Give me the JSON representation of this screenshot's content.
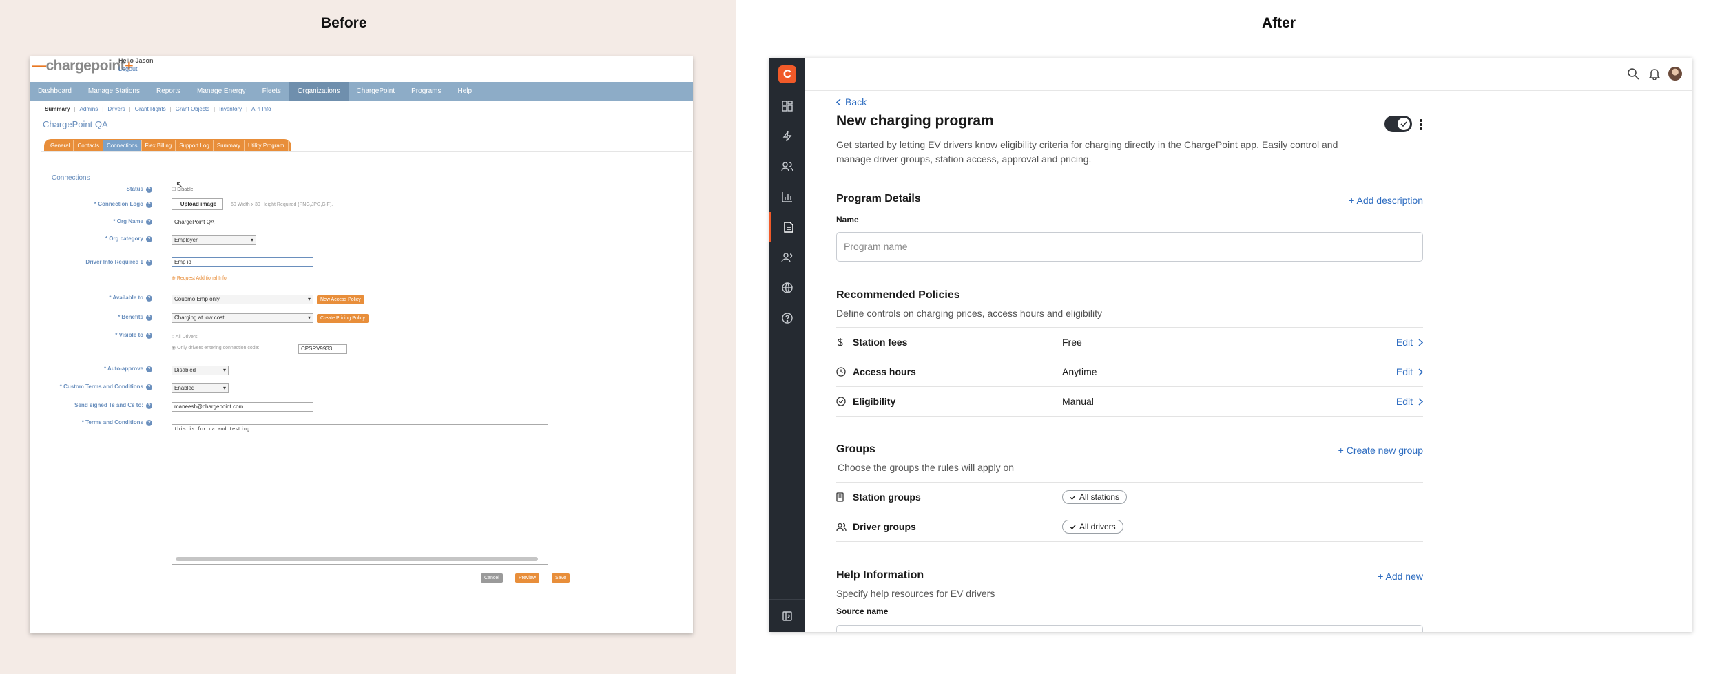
{
  "labels": {
    "before": "Before",
    "after": "After"
  },
  "old": {
    "logo": "chargepoint",
    "hello": "Hello Jason",
    "logout": "Logout",
    "nav": [
      "Dashboard",
      "Manage Stations",
      "Reports",
      "Manage Energy",
      "Fleets",
      "Organizations",
      "ChargePoint",
      "Programs",
      "Help"
    ],
    "subnav": [
      "Summary",
      "Admins",
      "Drivers",
      "Grant Rights",
      "Grant Objects",
      "Inventory",
      "API Info"
    ],
    "org_title": "ChargePoint QA",
    "tabs": [
      "General",
      "Contacts",
      "Connections",
      "Flex Billing",
      "Support Log",
      "Summary",
      "Utility Program"
    ],
    "panel_title": "Connections",
    "fields": {
      "status_label": "Status",
      "status_value": "Disable",
      "logo_label": "* Connection Logo",
      "logo_button": "Upload image",
      "logo_hint": "60 Width x 30 Height Required (PNG,JPG,GIF).",
      "org_name_label": "* Org Name",
      "org_name_value": "ChargePoint QA",
      "org_cat_label": "* Org category",
      "org_cat_value": "Employer",
      "driver_info_label": "Driver Info Required 1",
      "driver_info_value": "Emp id",
      "request_info": "Request Additional Info",
      "available_label": "* Available to",
      "available_value": "Couomo Emp only",
      "access_btn": "New Access Policy",
      "benefits_label": "* Benefits",
      "benefits_value": "Charging at low cost",
      "pricing_btn": "Create Pricing Policy",
      "visible_label": "* Visible to",
      "visible_opt1": "All Drivers",
      "visible_opt2": "Only drivers entering connection code:",
      "code_value": "CPSRV9933",
      "auto_label": "* Auto-approve",
      "auto_value": "Disabled",
      "custom_terms_label": "* Custom Terms and Conditions",
      "custom_terms_value": "Enabled",
      "send_label": "Send signed Ts and Cs to:",
      "send_value": "maneesh@chargepoint.com",
      "terms_label": "* Terms and Conditions",
      "terms_value": "this is for qa and testing"
    },
    "buttons": {
      "cancel": "Cancel",
      "preview": "Preview",
      "save": "Save"
    }
  },
  "new": {
    "back": "Back",
    "title": "New charging program",
    "description": "Get started by letting EV drivers know eligibility criteria for charging directly in the ChargePoint app. Easily control and manage driver groups, station access, approval and pricing.",
    "program_details": {
      "title": "Program Details",
      "link": "+ Add description",
      "name_label": "Name",
      "name_placeholder": "Program name"
    },
    "policies": {
      "title": "Recommended Policies",
      "subtitle": "Define controls on charging prices, access hours and eligibility",
      "rows": [
        {
          "name": "Station fees",
          "value": "Free",
          "action": "Edit",
          "icon": "dollar-icon"
        },
        {
          "name": "Access hours",
          "value": "Anytime",
          "action": "Edit",
          "icon": "clock-icon"
        },
        {
          "name": "Eligibility",
          "value": "Manual",
          "action": "Edit",
          "icon": "check-circle-icon"
        }
      ]
    },
    "groups": {
      "title": "Groups",
      "link": "+ Create new group",
      "subtitle": "Choose the groups the rules will apply on",
      "rows": [
        {
          "name": "Station groups",
          "chip": "All stations",
          "icon": "station-icon"
        },
        {
          "name": "Driver groups",
          "chip": "All drivers",
          "icon": "users-icon"
        }
      ]
    },
    "help": {
      "title": "Help Information",
      "link": "+ Add new",
      "subtitle": "Specify help resources for EV drivers",
      "source_label": "Source name"
    },
    "brand_color": "#f15a29",
    "link_color": "#2d6cc0"
  }
}
